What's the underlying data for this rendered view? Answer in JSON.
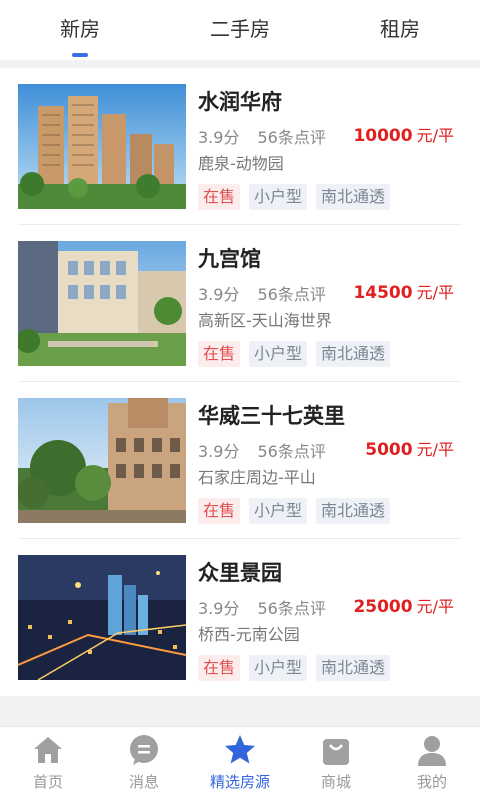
{
  "tabs": [
    {
      "label": "新房",
      "active": true
    },
    {
      "label": "二手房",
      "active": false
    },
    {
      "label": "租房",
      "active": false
    }
  ],
  "listings": [
    {
      "name": "水润华府",
      "rating": "3.9分",
      "reviews": "56条点评",
      "price": "10000",
      "unit": "元/平",
      "location": "鹿泉-动物园",
      "tags": [
        "在售",
        "小户型",
        "南北通透"
      ]
    },
    {
      "name": "九宫馆",
      "rating": "3.9分",
      "reviews": "56条点评",
      "price": "14500",
      "unit": "元/平",
      "location": "高新区-天山海世界",
      "tags": [
        "在售",
        "小户型",
        "南北通透"
      ]
    },
    {
      "name": "华威三十七英里",
      "rating": "3.9分",
      "reviews": "56条点评",
      "price": "5000",
      "unit": "元/平",
      "location": "石家庄周边-平山",
      "tags": [
        "在售",
        "小户型",
        "南北通透"
      ]
    },
    {
      "name": "众里景园",
      "rating": "3.9分",
      "reviews": "56条点评",
      "price": "25000",
      "unit": "元/平",
      "location": "桥西-元南公园",
      "tags": [
        "在售",
        "小户型",
        "南北通透"
      ]
    }
  ],
  "bottom_nav": [
    {
      "label": "首页",
      "icon": "home-icon",
      "active": false
    },
    {
      "label": "消息",
      "icon": "message-icon",
      "active": false
    },
    {
      "label": "精选房源",
      "icon": "star-icon",
      "active": true
    },
    {
      "label": "商城",
      "icon": "shopping-bag-icon",
      "active": false
    },
    {
      "label": "我的",
      "icon": "user-icon",
      "active": false
    }
  ],
  "colors": {
    "accent": "#3366dd",
    "price": "#e02020",
    "tag_sale_bg": "#fdecec",
    "tag_sale_text": "#e05050",
    "tag_bg": "#eef2f6",
    "tag_text": "#7b8796"
  }
}
